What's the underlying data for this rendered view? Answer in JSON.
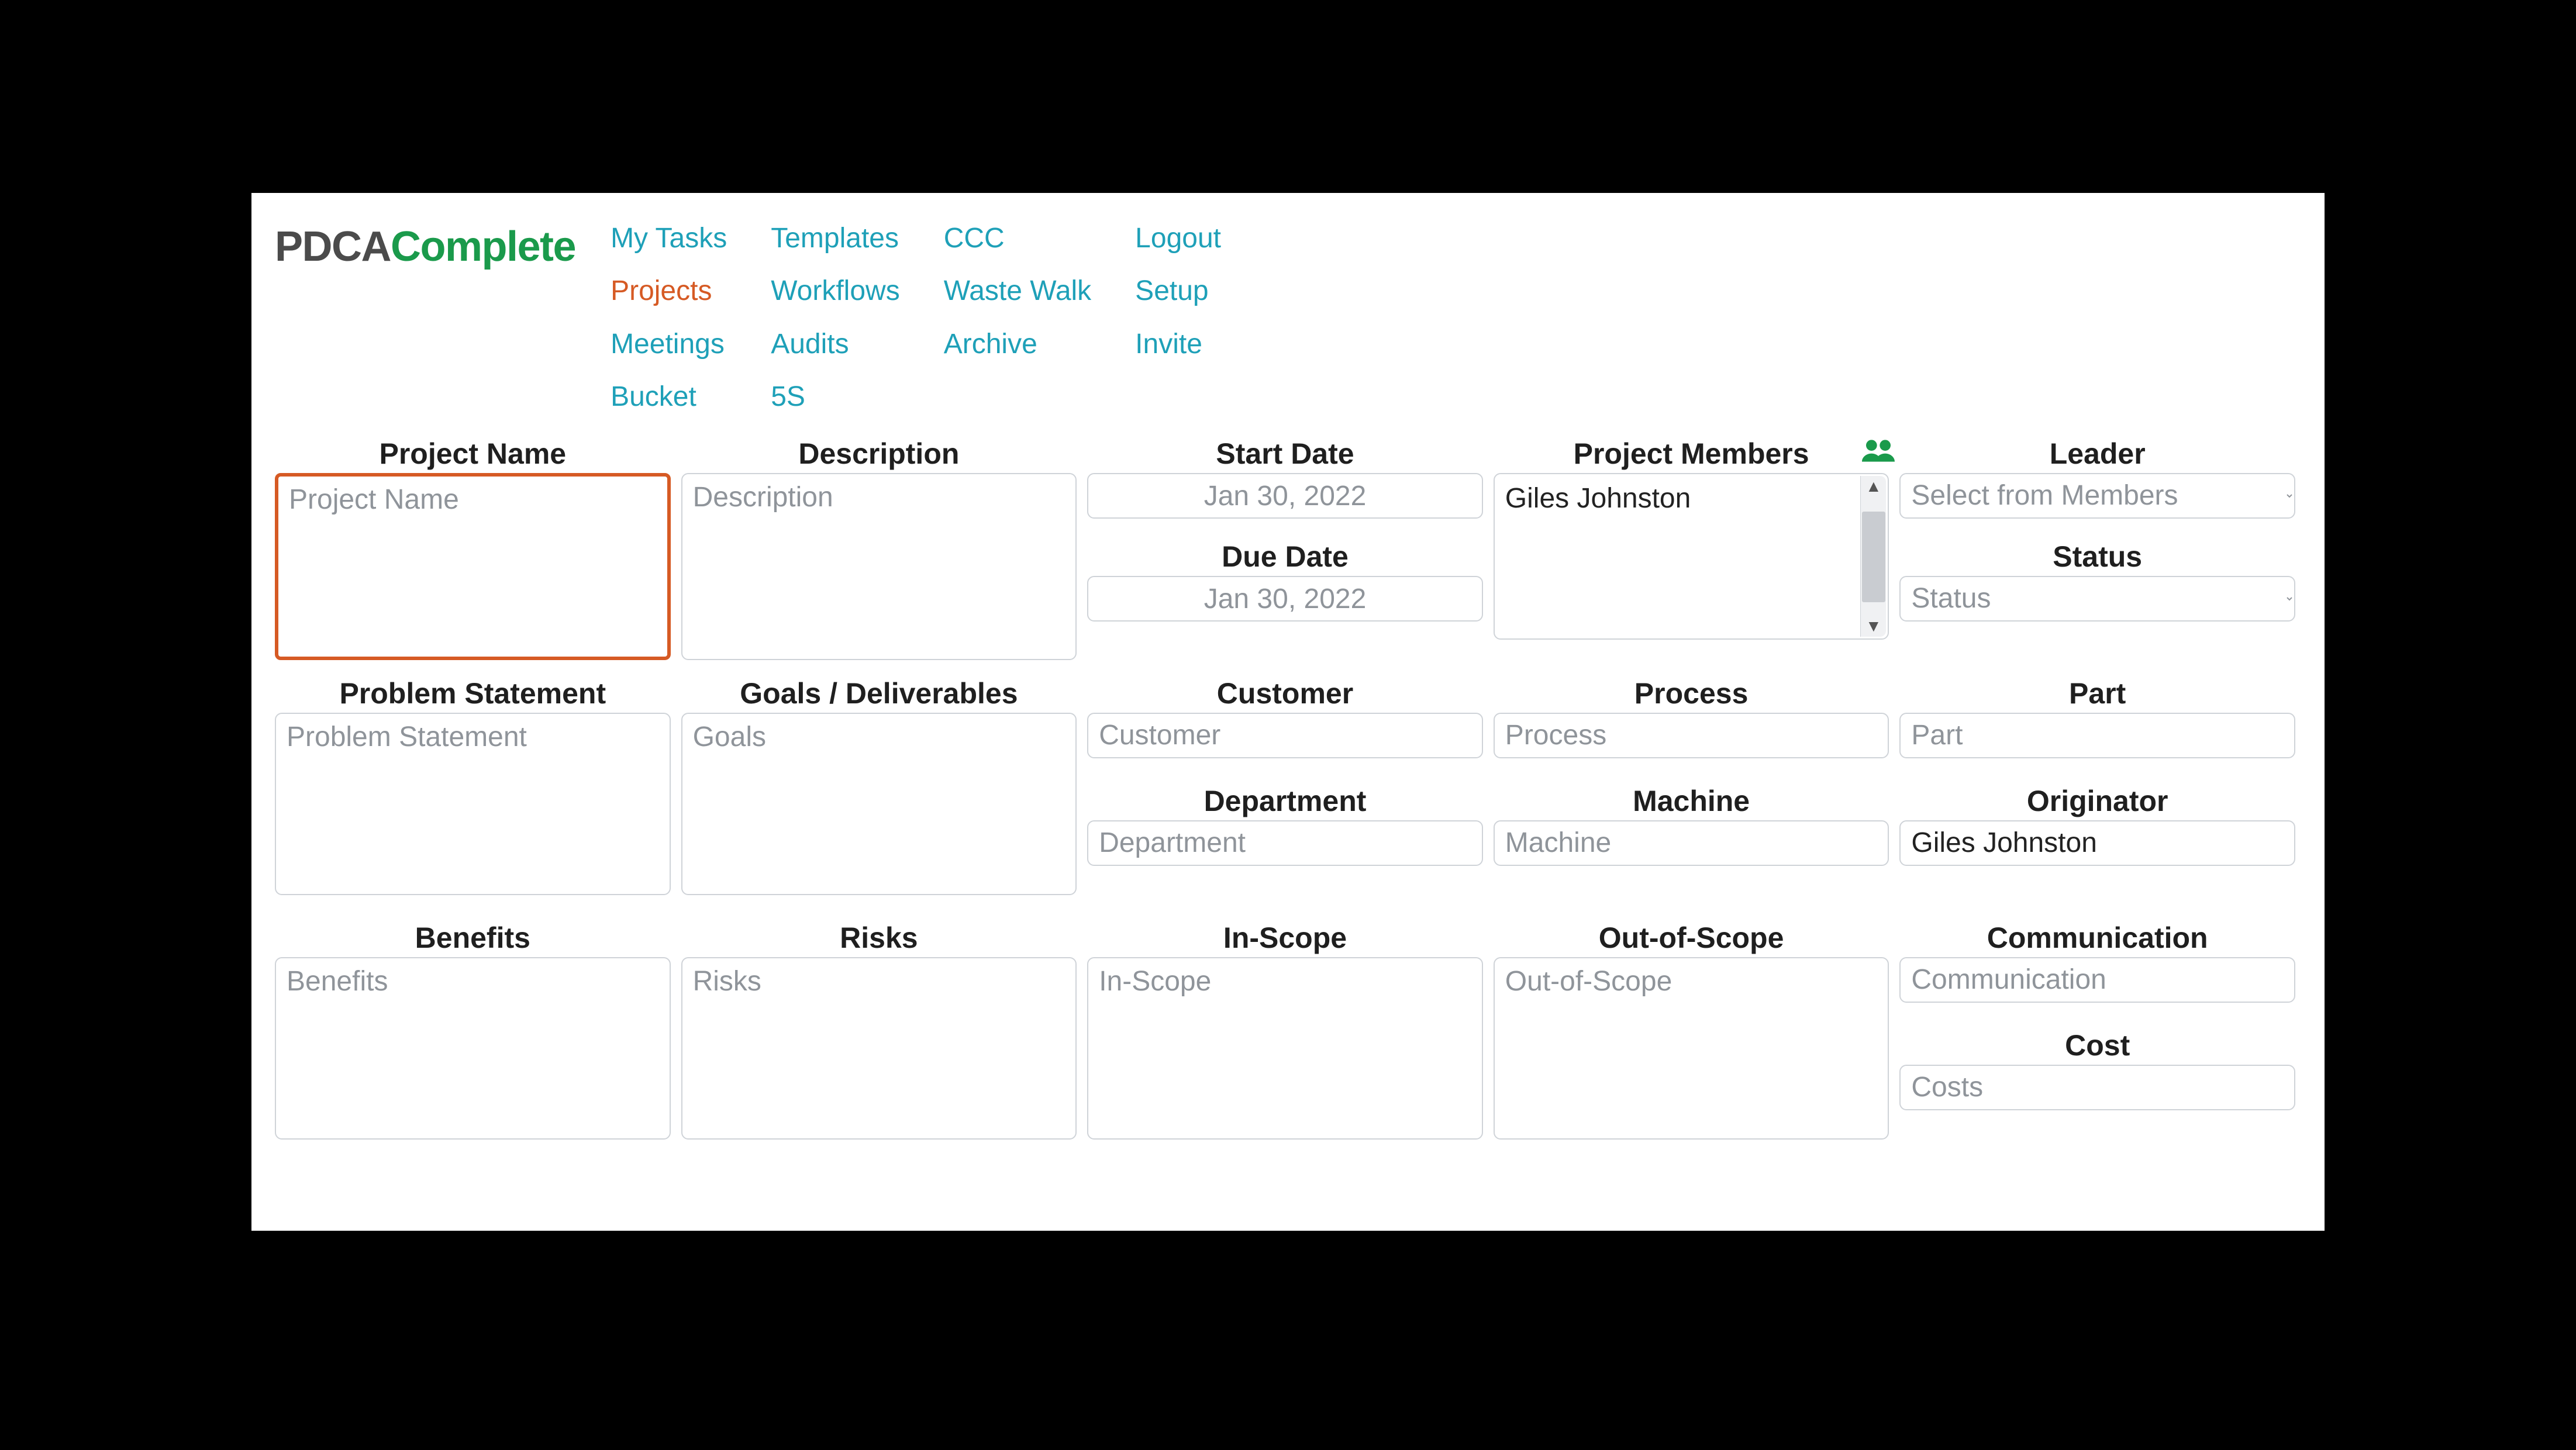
{
  "logo": {
    "part1": "PDCA",
    "part2": "Complete"
  },
  "nav": {
    "col1": [
      "My Tasks",
      "Projects",
      "Meetings",
      "Bucket"
    ],
    "col2": [
      "Templates",
      "Workflows",
      "Audits",
      "5S"
    ],
    "col3": [
      "CCC",
      "Waste Walk",
      "Archive"
    ],
    "col4": [
      "Logout",
      "Setup",
      "Invite"
    ],
    "active": "Projects"
  },
  "labels": {
    "projectName": "Project Name",
    "description": "Description",
    "startDate": "Start Date",
    "dueDate": "Due Date",
    "projectMembers": "Project Members",
    "leader": "Leader",
    "status": "Status",
    "problemStatement": "Problem Statement",
    "goals": "Goals / Deliverables",
    "customer": "Customer",
    "process": "Process",
    "part": "Part",
    "department": "Department",
    "machine": "Machine",
    "originator": "Originator",
    "benefits": "Benefits",
    "risks": "Risks",
    "inScope": "In-Scope",
    "outOfScope": "Out-of-Scope",
    "communication": "Communication",
    "cost": "Cost"
  },
  "placeholders": {
    "projectName": "Project Name",
    "description": "Description",
    "problemStatement": "Problem Statement",
    "goals": "Goals",
    "customer": "Customer",
    "process": "Process",
    "part": "Part",
    "department": "Department",
    "machine": "Machine",
    "benefits": "Benefits",
    "risks": "Risks",
    "inScope": "In-Scope",
    "outOfScope": "Out-of-Scope",
    "communication": "Communication",
    "costs": "Costs",
    "leader": "Select from Members",
    "status": "Status"
  },
  "values": {
    "startDate": "Jan 30, 2022",
    "dueDate": "Jan 30, 2022",
    "memberSelected": "Giles Johnston",
    "originator": "Giles Johnston"
  }
}
